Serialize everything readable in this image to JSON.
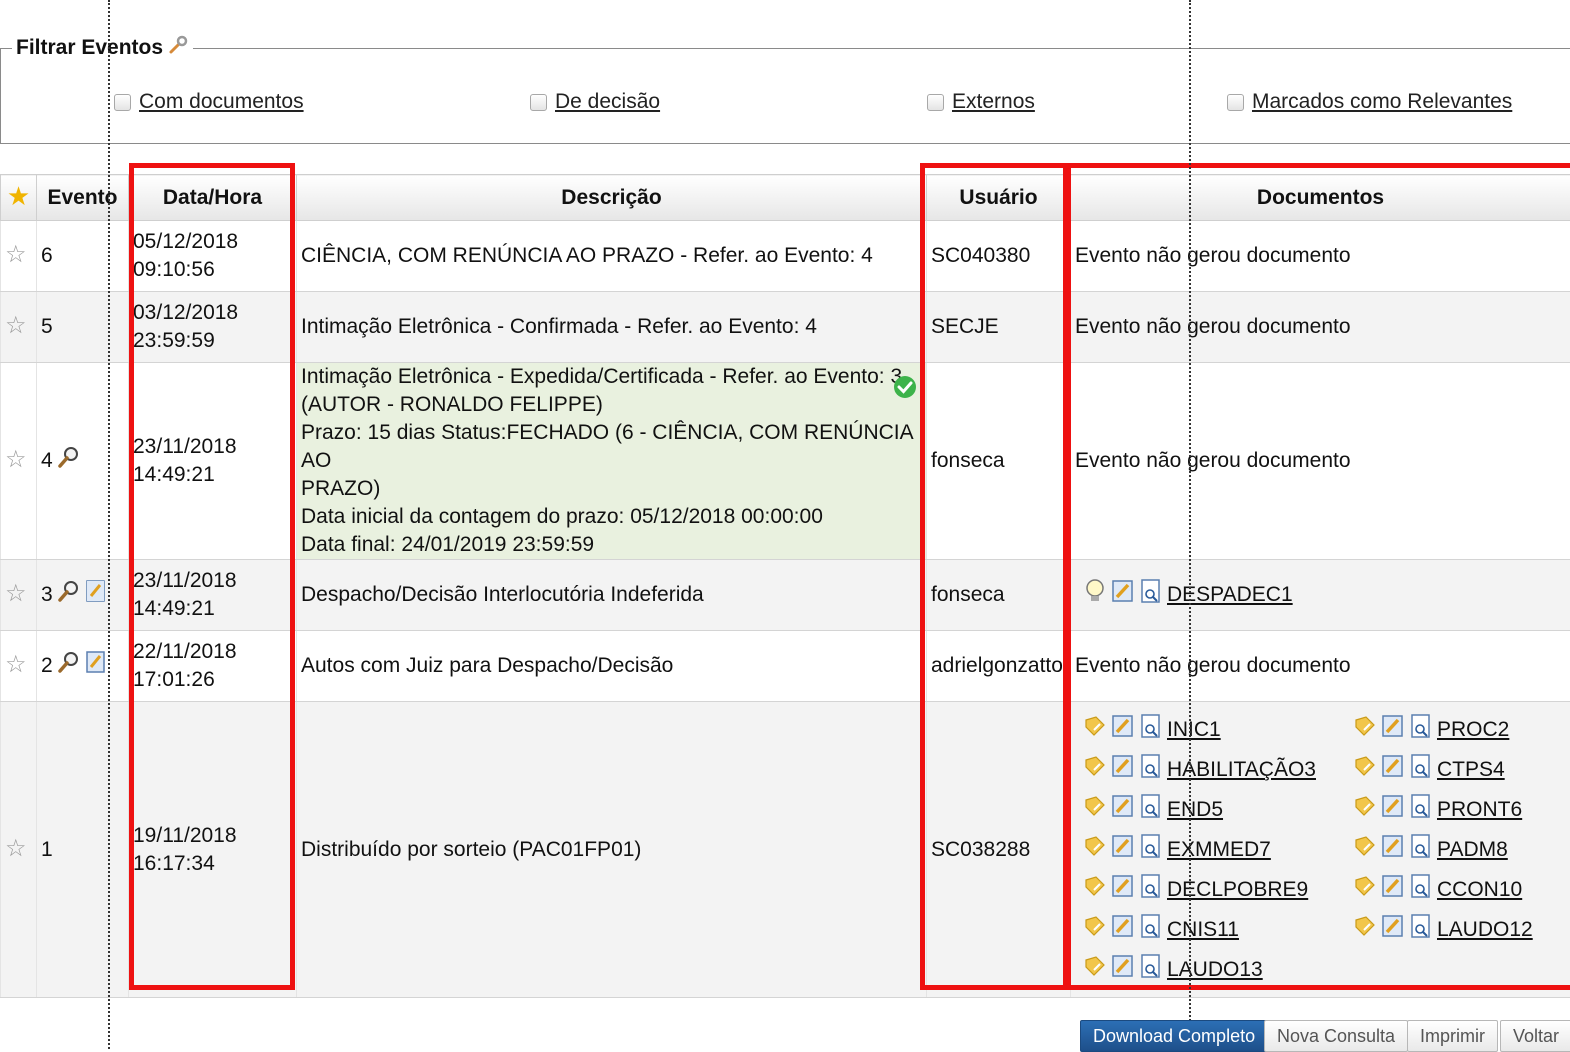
{
  "filter": {
    "legend": "Filtrar Eventos",
    "options": [
      {
        "label": "Com documentos"
      },
      {
        "label": "De decisão"
      },
      {
        "label": "Externos"
      },
      {
        "label": "Marcados como Relevantes"
      }
    ]
  },
  "table": {
    "headers": {
      "evento": "Evento",
      "data_hora": "Data/Hora",
      "descricao": "Descrição",
      "usuario": "Usuário",
      "documentos": "Documentos"
    },
    "rows": [
      {
        "evento": "6",
        "date": "05/12/2018",
        "time": "09:10:56",
        "desc": "CIÊNCIA, COM RENÚNCIA AO PRAZO - Refer. ao Evento: 4",
        "usuario": "SC040380",
        "docs_text": "Evento não gerou documento"
      },
      {
        "evento": "5",
        "date": "03/12/2018",
        "time": "23:59:59",
        "desc": "Intimação Eletrônica - Confirmada - Refer. ao Evento: 4",
        "usuario": "SECJE",
        "docs_text": "Evento não gerou documento"
      },
      {
        "evento": "4",
        "date": "23/11/2018",
        "time": "14:49:21",
        "desc_lines": [
          "Intimação Eletrônica - Expedida/Certificada - Refer. ao Evento: 3",
          "(AUTOR - RONALDO FELIPPE)",
          "Prazo: 15 dias Status:FECHADO (6 - CIÊNCIA, COM RENÚNCIA AO",
          "PRAZO)",
          "Data inicial da contagem do prazo: 05/12/2018 00:00:00",
          "Data final: 24/01/2019 23:59:59"
        ],
        "usuario": "fonseca",
        "docs_text": "Evento não gerou documento"
      },
      {
        "evento": "3",
        "date": "23/11/2018",
        "time": "14:49:21",
        "desc": "Despacho/Decisão Interlocutória Indeferida",
        "usuario": "fonseca",
        "doc_links": [
          "DESPADEC1"
        ]
      },
      {
        "evento": "2",
        "date": "22/11/2018",
        "time": "17:01:26",
        "desc": "Autos com Juiz para Despacho/Decisão",
        "usuario": "adrielgonzatto",
        "docs_text": "Evento não gerou documento"
      },
      {
        "evento": "1",
        "date": "19/11/2018",
        "time": "16:17:34",
        "desc": "Distribuído por sorteio (PAC01FP01)",
        "usuario": "SC038288",
        "doc_links": [
          "INIC1",
          "PROC2",
          "HABILITAÇÃO3",
          "CTPS4",
          "END5",
          "PRONT6",
          "EXMMED7",
          "PADM8",
          "DECLPOBRE9",
          "CCON10",
          "CNIS11",
          "LAUDO12",
          "LAUDO13"
        ]
      }
    ]
  },
  "buttons": {
    "download": "Download Completo",
    "nova": "Nova Consulta",
    "imprimir": "Imprimir",
    "voltar": "Voltar"
  },
  "colors": {
    "highlight": "#ee1111",
    "green_row": "#e9f1df",
    "primary_button": "#1e4f8a"
  }
}
